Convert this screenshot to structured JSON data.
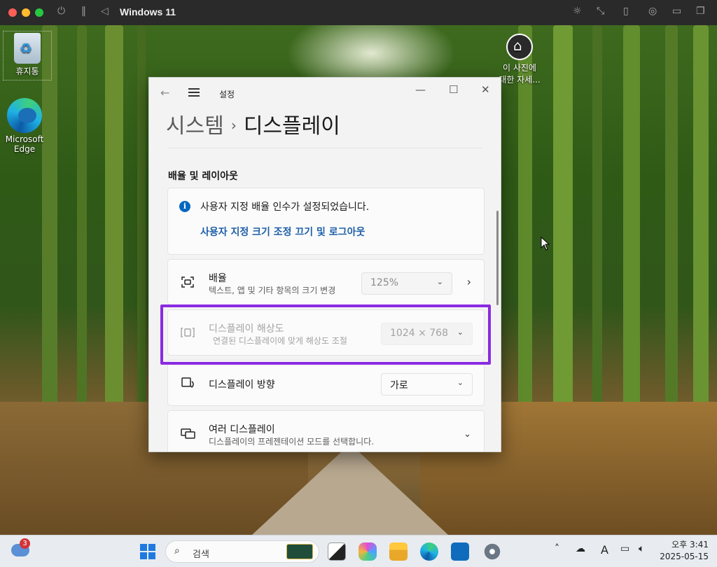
{
  "mac": {
    "title": "Windows 11",
    "power_icon": "⏻",
    "pause_icon": "‖",
    "back_icon": "◁"
  },
  "desktop": {
    "recycle_bin": "휴지통",
    "edge_line1": "Microsoft",
    "edge_line2": "Edge",
    "photo_line1": "이 사진에",
    "photo_line2": "대한 자세..."
  },
  "settings": {
    "window_title": "설정",
    "breadcrumb_parent": "시스템",
    "breadcrumb_sep": "›",
    "breadcrumb_current": "디스플레이",
    "section_title": "배율 및 레이아웃",
    "info_text": "사용자 지정 배율 인수가 설정되었습니다.",
    "info_link": "사용자 지정 크기 조정 끄기 및 로그아웃",
    "scale": {
      "title": "배율",
      "subtitle": "텍스트, 앱 및 기타 항목의 크기 변경",
      "value": "125%"
    },
    "resolution": {
      "title": "디스플레이 해상도",
      "subtitle": "연결된 디스플레이에 맞게 해상도 조절",
      "value": "1024 × 768"
    },
    "orientation": {
      "title": "디스플레이 방향",
      "value": "가로"
    },
    "multi": {
      "title": "여러 디스플레이",
      "subtitle": "디스플레이의 프레젠테이션 모드를 선택합니다."
    },
    "highlight_color": "#8a2be2"
  },
  "taskbar": {
    "weather_badge": "3",
    "search_placeholder": "검색",
    "clock_time": "오후 3:41",
    "clock_date": "2025-05-15",
    "ime": "A"
  }
}
